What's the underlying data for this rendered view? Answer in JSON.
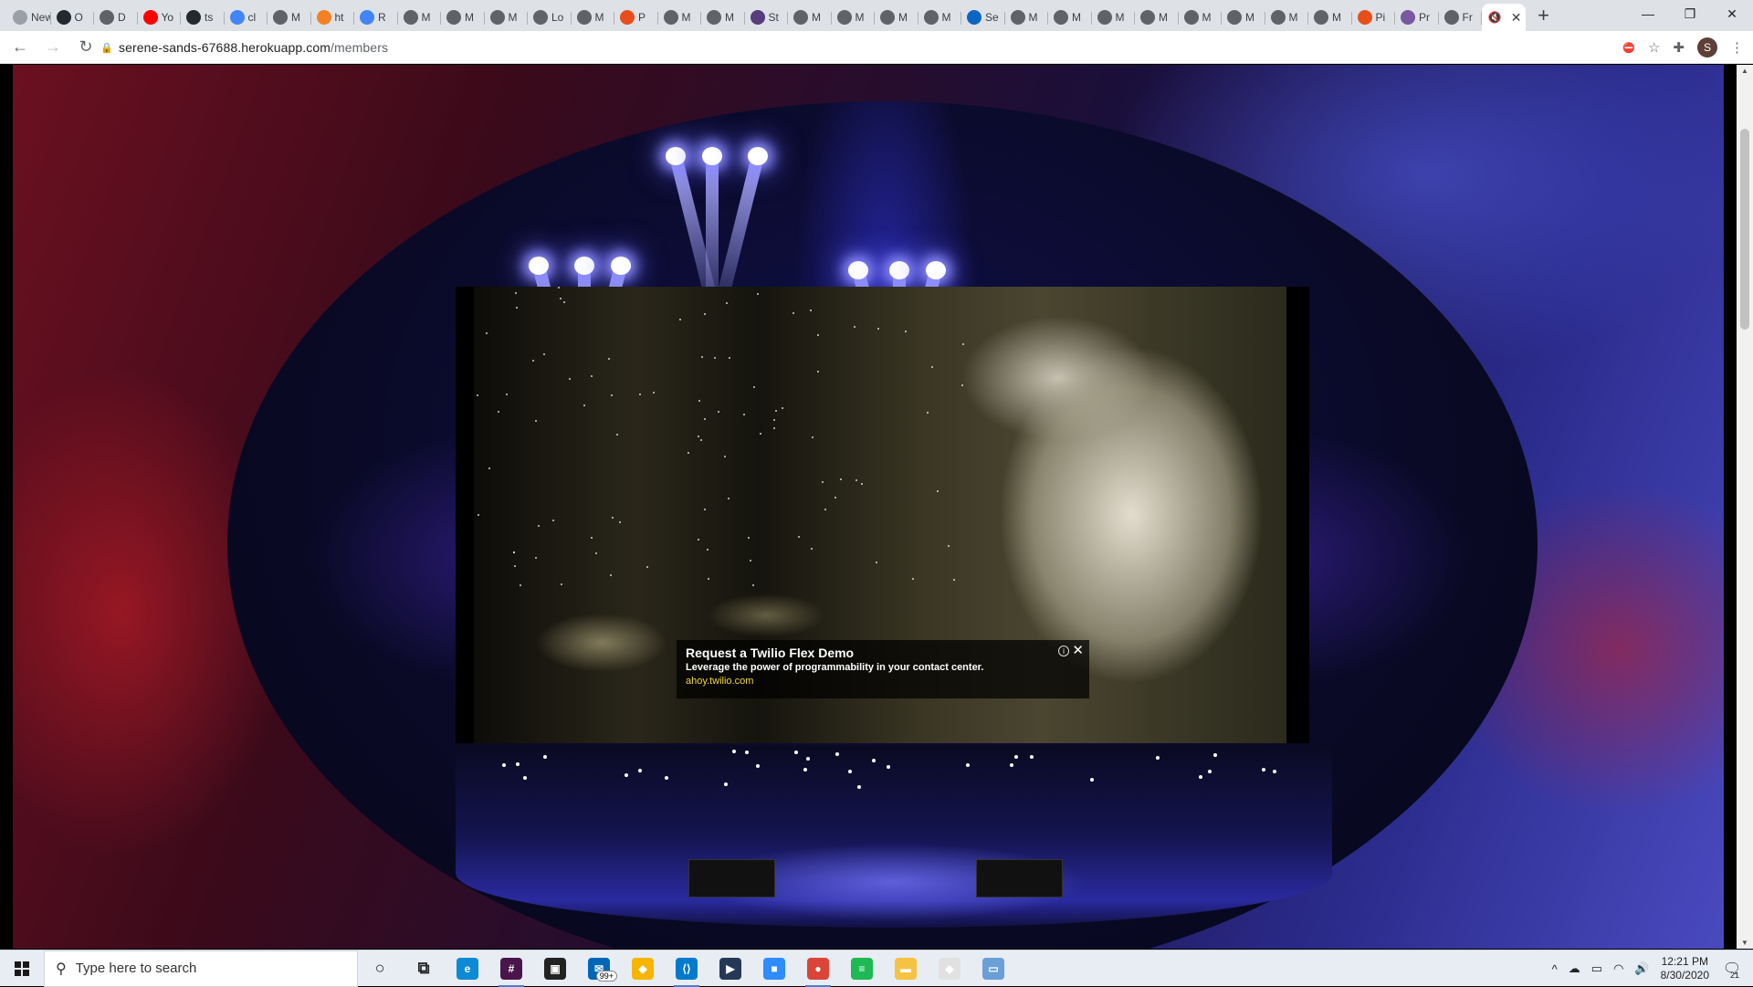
{
  "browser": {
    "tabs": [
      {
        "label": "New T",
        "icon": "new-tab-icon",
        "color": "#9aa0a6"
      },
      {
        "label": "O",
        "icon": "github-icon",
        "color": "#24292e"
      },
      {
        "label": "D",
        "icon": "globe-icon",
        "color": "#5f6368"
      },
      {
        "label": "Yo",
        "icon": "youtube-icon",
        "color": "#ff0000"
      },
      {
        "label": "ts",
        "icon": "github-icon",
        "color": "#24292e"
      },
      {
        "label": "cl",
        "icon": "google-icon",
        "color": "#4285f4"
      },
      {
        "label": "M",
        "icon": "globe-icon",
        "color": "#5f6368"
      },
      {
        "label": "ht",
        "icon": "stackoverflow-icon",
        "color": "#f48024"
      },
      {
        "label": "R",
        "icon": "docs-icon",
        "color": "#4285f4"
      },
      {
        "label": "M",
        "icon": "globe-icon",
        "color": "#5f6368"
      },
      {
        "label": "M",
        "icon": "globe-icon",
        "color": "#5f6368"
      },
      {
        "label": "M",
        "icon": "globe-icon",
        "color": "#5f6368"
      },
      {
        "label": "Lo",
        "icon": "globe-icon",
        "color": "#5f6368"
      },
      {
        "label": "M",
        "icon": "globe-icon",
        "color": "#5f6368"
      },
      {
        "label": "P",
        "icon": "pinwheel-icon",
        "color": "#e84e1b"
      },
      {
        "label": "M",
        "icon": "globe-icon",
        "color": "#5f6368"
      },
      {
        "label": "M",
        "icon": "globe-icon",
        "color": "#5f6368"
      },
      {
        "label": "St",
        "icon": "bootstrap-icon",
        "color": "#563d7c"
      },
      {
        "label": "M",
        "icon": "globe-icon",
        "color": "#5f6368"
      },
      {
        "label": "M",
        "icon": "globe-icon",
        "color": "#5f6368"
      },
      {
        "label": "M",
        "icon": "globe-icon",
        "color": "#5f6368"
      },
      {
        "label": "M",
        "icon": "globe-icon",
        "color": "#5f6368"
      },
      {
        "label": "Se",
        "icon": "linkedin-icon",
        "color": "#0a66c2"
      },
      {
        "label": "M",
        "icon": "globe-icon",
        "color": "#5f6368"
      },
      {
        "label": "M",
        "icon": "globe-icon",
        "color": "#5f6368"
      },
      {
        "label": "M",
        "icon": "globe-icon",
        "color": "#5f6368"
      },
      {
        "label": "M",
        "icon": "globe-icon",
        "color": "#5f6368"
      },
      {
        "label": "M",
        "icon": "globe-icon",
        "color": "#5f6368"
      },
      {
        "label": "M",
        "icon": "globe-icon",
        "color": "#5f6368"
      },
      {
        "label": "M",
        "icon": "globe-icon",
        "color": "#5f6368"
      },
      {
        "label": "M",
        "icon": "globe-icon",
        "color": "#5f6368"
      },
      {
        "label": "Pi",
        "icon": "pinwheel-icon",
        "color": "#e84e1b"
      },
      {
        "label": "Pr",
        "icon": "heroku-icon",
        "color": "#79589f"
      },
      {
        "label": "Fr",
        "icon": "globe-icon",
        "color": "#5f6368"
      }
    ],
    "active_tab": {
      "label": "",
      "icon": "muted-icon",
      "close": "✕"
    },
    "new_tab": "+",
    "window_controls": {
      "minimize": "—",
      "restore": "❐",
      "close": "✕"
    },
    "nav": {
      "back": "←",
      "forward": "→",
      "reload": "↻"
    },
    "address": {
      "lock": "🔒",
      "host": "serene-sands-67688.herokuapp.com",
      "path": "/members"
    },
    "toolbar_icons": {
      "cookie": "⛔",
      "star": "☆",
      "extensions": "✚",
      "profile": "S",
      "menu": "⋮"
    }
  },
  "ad": {
    "title": "Request a Twilio Flex Demo",
    "description": "Leverage the power of programmability in your contact center.",
    "url": "ahoy.twilio.com",
    "info": "i",
    "close": "✕"
  },
  "taskbar": {
    "search_placeholder": "Type here to search",
    "apps": [
      {
        "name": "cortana-icon",
        "label": "○",
        "color": "#222",
        "running": false
      },
      {
        "name": "task-view-icon",
        "label": "⧉",
        "color": "#222",
        "running": false
      },
      {
        "name": "edge-icon",
        "label": "e",
        "color": "#0c8ad6",
        "running": false
      },
      {
        "name": "slack-icon",
        "label": "#",
        "color": "#4a154b",
        "running": true
      },
      {
        "name": "store-icon",
        "label": "▣",
        "color": "#222",
        "running": false
      },
      {
        "name": "mail-icon",
        "label": "✉",
        "color": "#0067b8",
        "running": false,
        "badge": "99+"
      },
      {
        "name": "sketch-icon",
        "label": "◆",
        "color": "#f7b500",
        "running": false
      },
      {
        "name": "vscode-icon",
        "label": "⟨⟩",
        "color": "#007acc",
        "running": true
      },
      {
        "name": "vs-icon",
        "label": "▶",
        "color": "#253858",
        "running": false
      },
      {
        "name": "zoom-icon",
        "label": "■",
        "color": "#2d8cff",
        "running": false
      },
      {
        "name": "chrome-icon",
        "label": "●",
        "color": "#db4437",
        "running": true
      },
      {
        "name": "spotify-icon",
        "label": "≡",
        "color": "#1db954",
        "running": false
      },
      {
        "name": "explorer-icon",
        "label": "▬",
        "color": "#f5c242",
        "running": false
      },
      {
        "name": "sourcetree-icon",
        "label": "◆",
        "color": "#e1e1e1",
        "running": false
      },
      {
        "name": "terminal-icon",
        "label": "▭",
        "color": "#6a9fd8",
        "running": false
      }
    ],
    "tray": {
      "chevron": "^",
      "onedrive": "☁",
      "battery": "▭",
      "wifi": "◠",
      "volume": "🔊"
    },
    "time": "12:21 PM",
    "date": "8/30/2020",
    "notifications": "21"
  }
}
